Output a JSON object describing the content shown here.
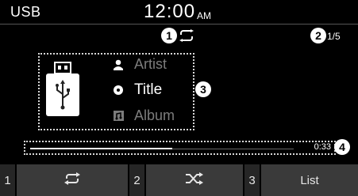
{
  "status_bar": {
    "source": "USB",
    "time": "12:00",
    "ampm": "AM"
  },
  "markers": {
    "repeat": "1",
    "counter": "2",
    "info": "3",
    "progress": "4"
  },
  "track": {
    "counter": "1/5",
    "artist": "Artist",
    "title": "Title",
    "album": "Album"
  },
  "progress": {
    "elapsed": "0:33",
    "fraction": 0.54
  },
  "bottom_bar": {
    "num1": "1",
    "btn1_icon": "repeat-icon",
    "num2": "2",
    "btn2_icon": "shuffle-icon",
    "num3": "3",
    "btn3_label": "List"
  },
  "colors": {
    "background": "#000000",
    "text": "#ffffff",
    "dim_text": "#7c7c7c",
    "button": "#3a3a3a"
  }
}
